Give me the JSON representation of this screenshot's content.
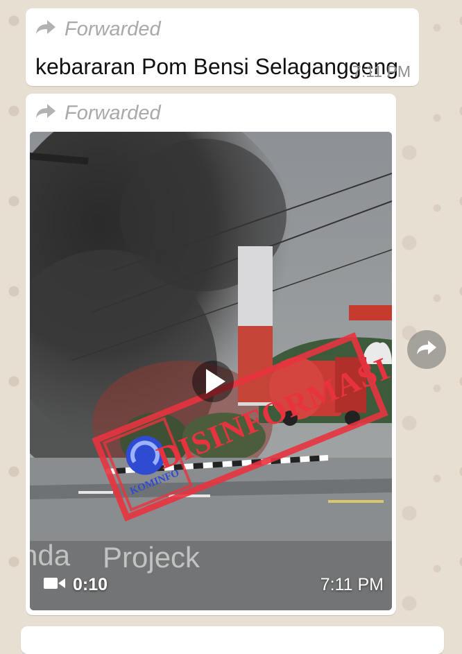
{
  "messages": [
    {
      "forwarded_label": "Forwarded",
      "text": "kebararan Pom Bensi Selaganggeng",
      "time": "7:11 PM"
    },
    {
      "forwarded_label": "Forwarded",
      "video": {
        "duration": "0:10",
        "time": "7:11 PM",
        "watermark": "Projeck",
        "watermark_prefix": "nda",
        "stamp_text": "DISINFORMASI",
        "stamp_logo_text": "KOMINFO"
      }
    }
  ],
  "icons": {
    "forward": "forward-arrow-icon",
    "share": "share-icon",
    "video": "video-camera-icon",
    "play": "play-icon"
  },
  "colors": {
    "chat_background": "#e8dfd3",
    "bubble": "#ffffff",
    "stamp_red": "#e8333f",
    "kominfo_blue": "#2f4bd1"
  }
}
